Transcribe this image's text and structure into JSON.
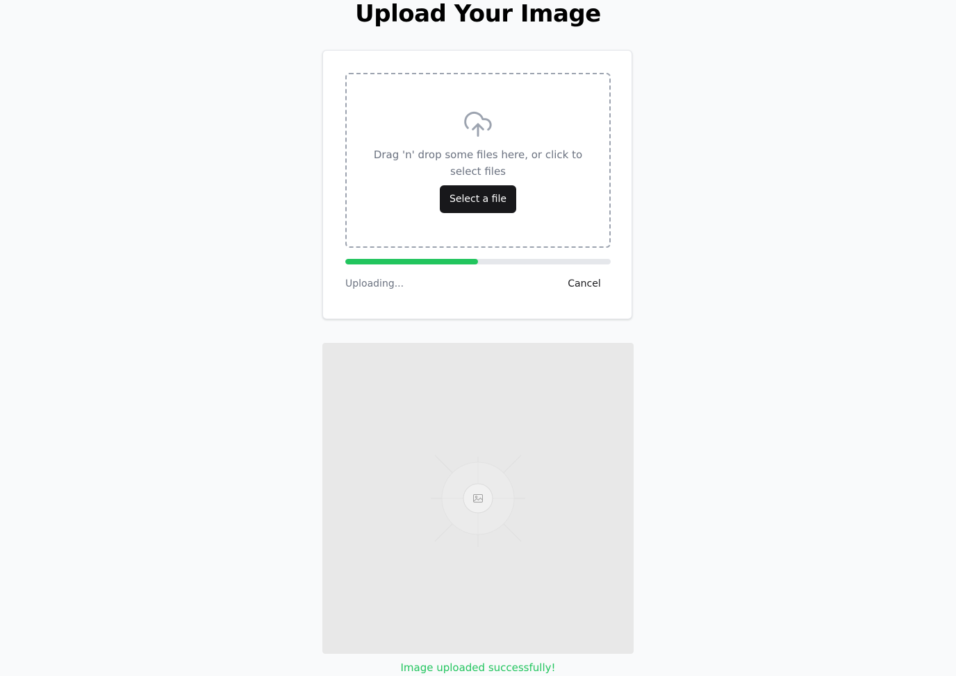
{
  "page": {
    "title": "Upload Your Image"
  },
  "dropzone": {
    "icon": "cloud-upload-icon",
    "instruction": "Drag 'n' drop some files here, or click to select files",
    "select_button_label": "Select a file"
  },
  "upload": {
    "progress_percent": 50,
    "status_label": "Uploading...",
    "cancel_label": "Cancel"
  },
  "preview": {
    "icon": "image-placeholder-icon"
  },
  "result": {
    "message": "Image uploaded successfully!"
  },
  "colors": {
    "accent_green": "#22c55e",
    "button_dark": "#18181b",
    "muted_text": "#6b7280",
    "page_background": "#f9fafb"
  }
}
